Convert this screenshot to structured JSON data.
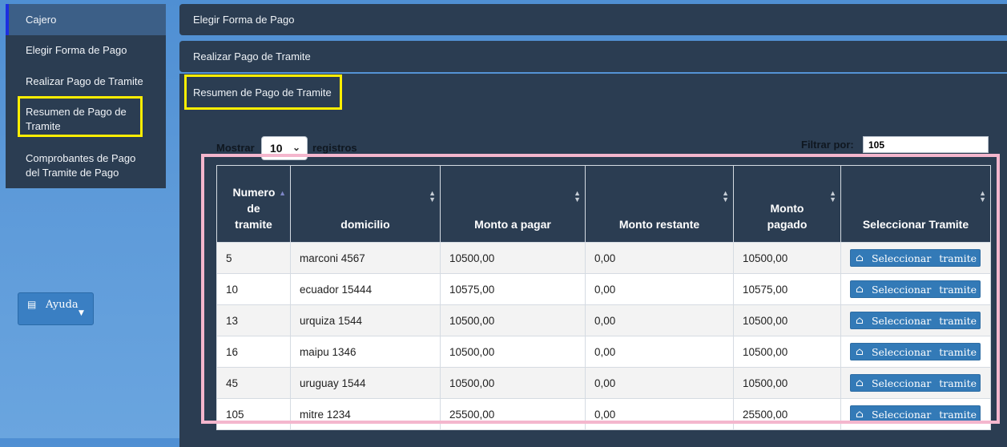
{
  "sidebar": {
    "items": [
      {
        "label": "Cajero"
      },
      {
        "label": "Elegir Forma de Pago"
      },
      {
        "label": "Realizar Pago de Tramite"
      },
      {
        "label": "Resumen de Pago de Tramite"
      },
      {
        "label": "Comprobantes de Pago del Tramite de Pago"
      }
    ]
  },
  "help": {
    "label": "Ayuda",
    "icon": "list-icon"
  },
  "panels": [
    {
      "title": "Elegir Forma de Pago"
    },
    {
      "title": "Realizar Pago de Tramite"
    },
    {
      "title": "Resumen de Pago de Tramite"
    }
  ],
  "controls": {
    "show_prefix": "Mostrar",
    "show_value": "10",
    "show_suffix": "registros",
    "filter_label": "Filtrar por:",
    "filter_value": "105"
  },
  "table": {
    "headers": [
      "Numero de tramite",
      "domicilio",
      "Monto a pagar",
      "Monto restante",
      "Monto pagado",
      "Seleccionar Tramite"
    ],
    "button_label": "Seleccionar tramite",
    "rows": [
      {
        "numero": "5",
        "domicilio": "marconi 4567",
        "monto_pagar": "10500,00",
        "monto_restante": "0,00",
        "monto_pagado": "10500,00"
      },
      {
        "numero": "10",
        "domicilio": "ecuador 15444",
        "monto_pagar": "10575,00",
        "monto_restante": "0,00",
        "monto_pagado": "10575,00"
      },
      {
        "numero": "13",
        "domicilio": "urquiza 1544",
        "monto_pagar": "10500,00",
        "monto_restante": "0,00",
        "monto_pagado": "10500,00"
      },
      {
        "numero": "16",
        "domicilio": "maipu 1346",
        "monto_pagar": "10500,00",
        "monto_restante": "0,00",
        "monto_pagado": "10500,00"
      },
      {
        "numero": "45",
        "domicilio": "uruguay 1544",
        "monto_pagar": "10500,00",
        "monto_restante": "0,00",
        "monto_pagado": "10500,00"
      },
      {
        "numero": "105",
        "domicilio": "mitre 1234",
        "monto_pagar": "25500,00",
        "monto_restante": "0,00",
        "monto_pagado": "25500,00"
      }
    ]
  },
  "colors": {
    "accent": "#337ab7",
    "panel": "#2b3d52",
    "highlight_yellow": "#ffee00",
    "highlight_pink": "#f4b6cd"
  }
}
